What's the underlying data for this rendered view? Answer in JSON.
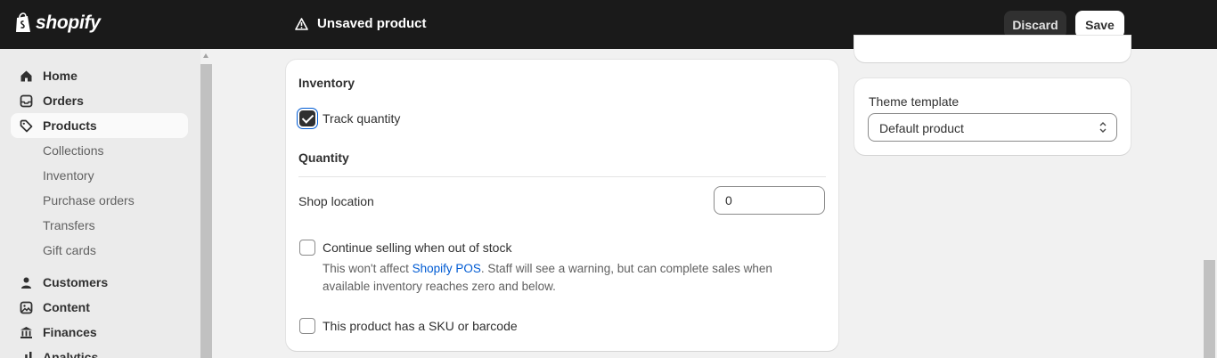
{
  "topbar": {
    "brand": "shopify",
    "status": "Unsaved product",
    "discard_label": "Discard",
    "save_label": "Save",
    "background": "#1a1a1a"
  },
  "sidebar": {
    "items": [
      {
        "label": "Home",
        "icon": "home-icon"
      },
      {
        "label": "Orders",
        "icon": "orders-icon"
      },
      {
        "label": "Products",
        "icon": "tag-icon",
        "active": true
      },
      {
        "label": "Customers",
        "icon": "person-icon"
      },
      {
        "label": "Content",
        "icon": "image-icon"
      },
      {
        "label": "Finances",
        "icon": "bank-icon"
      },
      {
        "label": "Analytics",
        "icon": "bar-chart-icon"
      }
    ],
    "product_subitems": [
      "Collections",
      "Inventory",
      "Purchase orders",
      "Transfers",
      "Gift cards"
    ]
  },
  "inventory": {
    "title": "Inventory",
    "track_quantity_label": "Track quantity",
    "track_quantity_checked": true,
    "quantity_title": "Quantity",
    "location_label": "Shop location",
    "location_value": "0",
    "continue_selling_label": "Continue selling when out of stock",
    "continue_selling_checked": false,
    "help_prefix": "This won't affect ",
    "help_link": "Shopify POS",
    "help_suffix": ". Staff will see a warning, but can complete sales when available inventory reaches zero and below.",
    "sku_label": "This product has a SKU or barcode",
    "sku_checked": false
  },
  "theme": {
    "label": "Theme template",
    "selected": "Default product"
  },
  "colors": {
    "link": "#005bd3",
    "accent": "#303030"
  }
}
